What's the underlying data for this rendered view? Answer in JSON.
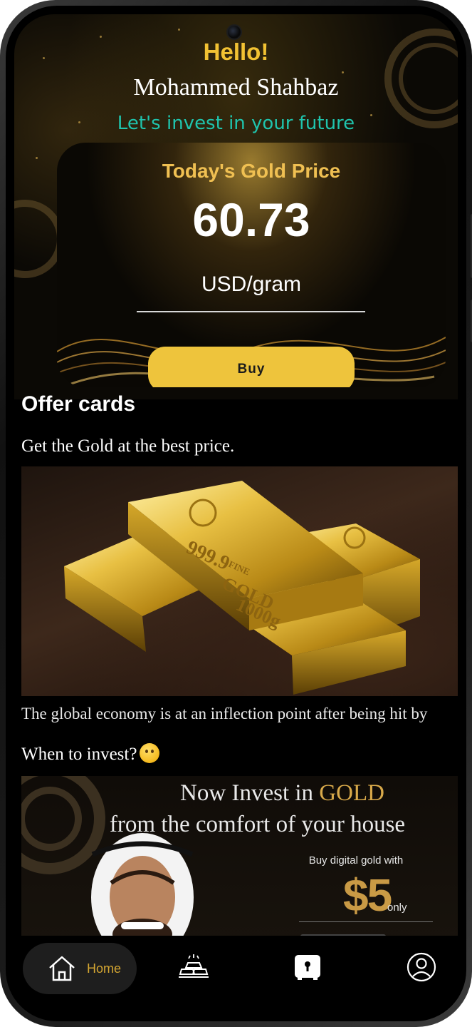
{
  "header": {
    "greeting": "Hello!",
    "user_name": "Mohammed Shahbaz",
    "tagline": "Let's invest in your future"
  },
  "price_card": {
    "title": "Today's Gold Price",
    "price": "60.73",
    "unit": "USD/gram",
    "buy_label": "Buy"
  },
  "offers": {
    "section_title": "Offer cards",
    "card1": {
      "subtitle": "Get the Gold at the best price.",
      "image_text": [
        "999.9",
        "FINE",
        "GOLD",
        "1000g"
      ],
      "description": "The global economy is at an inflection point after being hit by"
    },
    "card2": {
      "subtitle": "When to invest?",
      "emoji": "thinking-face",
      "promo_line1_prefix": "Now Invest in ",
      "promo_line1_highlight": "GOLD",
      "promo_line2": "from the comfort of your house",
      "promo_small": "Buy digital gold with",
      "promo_amount": "$5",
      "promo_only": "only"
    }
  },
  "bottom_nav": {
    "items": [
      {
        "label": "Home",
        "icon": "home-icon",
        "active": true
      },
      {
        "label": "",
        "icon": "gold-bars-icon",
        "active": false
      },
      {
        "label": "",
        "icon": "vault-icon",
        "active": false
      },
      {
        "label": "",
        "icon": "profile-icon",
        "active": false
      }
    ]
  },
  "colors": {
    "accent_gold": "#f2c233",
    "button_gold": "#eec43c",
    "tagline_teal": "#1fc4ad",
    "background": "#000000"
  }
}
